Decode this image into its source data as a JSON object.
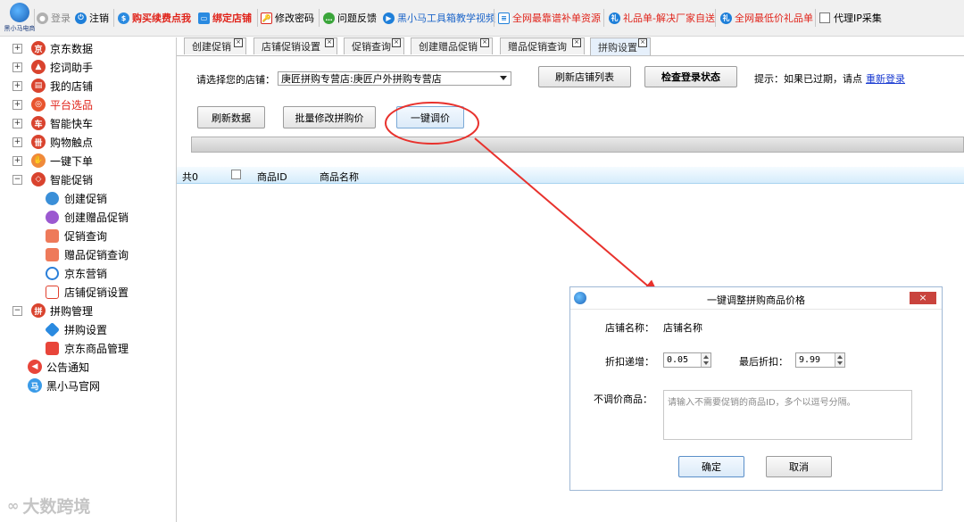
{
  "toolbar": {
    "logo_text": "黑小马电商",
    "login": "登录",
    "logout": "注销",
    "buy_renew": "购买续费点我",
    "bind_shop": "绑定店铺",
    "change_password": "修改密码",
    "feedback": "问题反馈",
    "tutorial": "黑小马工具箱教学视频",
    "resources": "全网最靠谱补单资源",
    "gift_list": "礼品单-解决厂家自送",
    "lowest_gift": "全网最低价礼品单",
    "proxy_ip": "代理IP采集"
  },
  "sidebar": {
    "items": [
      {
        "label": "京东数据",
        "expander": "+"
      },
      {
        "label": "挖词助手",
        "expander": "+"
      },
      {
        "label": "我的店铺",
        "expander": "+"
      },
      {
        "label": "平台选品",
        "expander": "+"
      },
      {
        "label": "智能快车",
        "expander": "+"
      },
      {
        "label": "购物触点",
        "expander": "+"
      },
      {
        "label": "一键下单",
        "expander": "+"
      },
      {
        "label": "智能促销",
        "expander": "−"
      },
      {
        "label": "创建促销"
      },
      {
        "label": "创建赠品促销"
      },
      {
        "label": "促销查询"
      },
      {
        "label": "赠品促销查询"
      },
      {
        "label": "京东营销"
      },
      {
        "label": "店铺促销设置"
      },
      {
        "label": "拼购管理",
        "expander": "−"
      },
      {
        "label": "拼购设置"
      },
      {
        "label": "京东商品管理"
      },
      {
        "label": "公告通知"
      },
      {
        "label": "黑小马官网"
      }
    ]
  },
  "tabs": [
    {
      "label": "创建促销"
    },
    {
      "label": "店铺促销设置"
    },
    {
      "label": "促销查询"
    },
    {
      "label": "创建赠品促销"
    },
    {
      "label": "赠品促销查询"
    },
    {
      "label": "拼购设置"
    }
  ],
  "main": {
    "shop_label": "请选择您的店铺：",
    "shop_value": "庚匠拼购专营店:庚匠户外拼购专营店",
    "refresh_shops": "刷新店铺列表",
    "check_login": "检查登录状态",
    "hint": "提示：如果已过期，请点",
    "relogin": "重新登录",
    "refresh_data": "刷新数据",
    "batch_edit": "批量修改拼购价",
    "one_click": "一键调价",
    "grid": {
      "count": "共0",
      "col_id": "商品ID",
      "col_name": "商品名称"
    }
  },
  "dialog": {
    "title": "一键调整拼购商品价格",
    "close": "×",
    "shop_label": "店铺名称：",
    "shop_value": "店铺名称",
    "discount_step_label": "折扣递增：",
    "discount_step": "0.05",
    "final_discount_label": "最后折扣：",
    "final_discount": "9.99",
    "exclude_label": "不调价商品：",
    "exclude_placeholder": "请输入不需要促销的商品ID，多个以逗号分隔。",
    "ok": "确定",
    "cancel": "取消"
  },
  "watermark": "大数跨境",
  "colors": {
    "annotation": "#e8322d",
    "link": "#1a3bd1",
    "accent": "#3a8fd8"
  }
}
